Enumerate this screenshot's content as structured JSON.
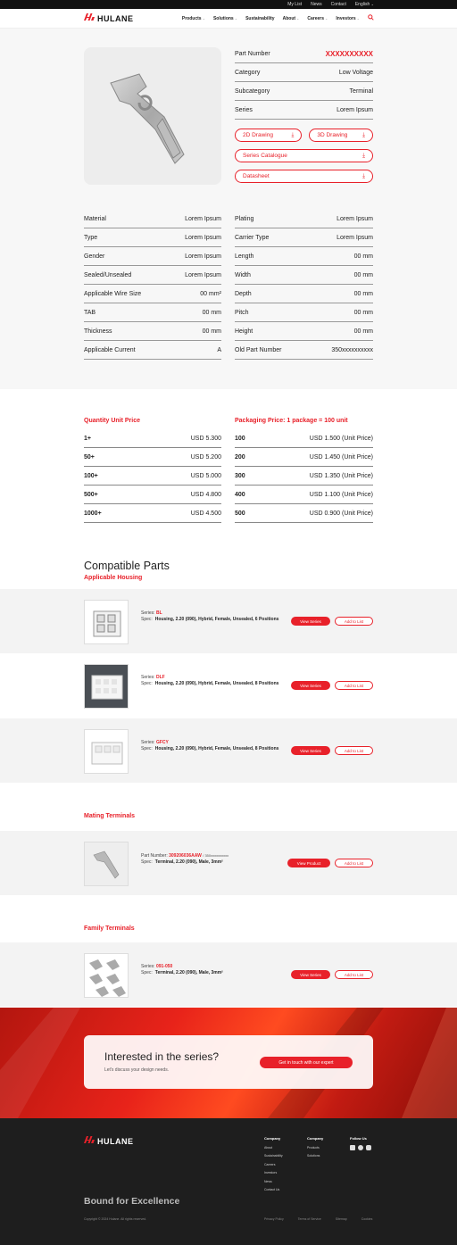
{
  "topbar": {
    "my_list": "My List",
    "news": "News",
    "contact": "Contact",
    "language": "English"
  },
  "nav": {
    "brand": "HULANE",
    "links": [
      "Products",
      "Solutions",
      "Sustainability",
      "About",
      "Careers",
      "Investors"
    ]
  },
  "product": {
    "part_number_label": "Part Number",
    "part_number": "XXXXXXXXXX",
    "category_label": "Category",
    "category": "Low Voltage",
    "subcategory_label": "Subcategory",
    "subcategory": "Terminal",
    "series_label": "Series",
    "series": "Lorem Ipsum",
    "btn_2d": "2D Drawing",
    "btn_3d": "3D Drawing",
    "btn_catalogue": "Series Catalogue",
    "btn_datasheet": "Datasheet"
  },
  "specs_left": [
    {
      "k": "Material",
      "v": "Lorem Ipsum"
    },
    {
      "k": "Type",
      "v": "Lorem Ipsum"
    },
    {
      "k": "Gender",
      "v": "Lorem Ipsum"
    },
    {
      "k": "Sealed/Unsealed",
      "v": "Lorem Ipsum"
    },
    {
      "k": "Applicable Wire Size",
      "v": "00 mm²"
    },
    {
      "k": "TAB",
      "v": "00 mm"
    },
    {
      "k": "Thickness",
      "v": "00 mm"
    },
    {
      "k": "Applicable Current",
      "v": "A"
    }
  ],
  "specs_right": [
    {
      "k": "Plating",
      "v": "Lorem Ipsum"
    },
    {
      "k": "Carrier Type",
      "v": "Lorem Ipsum"
    },
    {
      "k": "Length",
      "v": "00 mm"
    },
    {
      "k": "Width",
      "v": "00 mm"
    },
    {
      "k": "Depth",
      "v": "00 mm"
    },
    {
      "k": "Pitch",
      "v": "00 mm"
    },
    {
      "k": "Height",
      "v": "00 mm"
    },
    {
      "k": "Old Part Number",
      "v": "350xxxxxxxxxx"
    }
  ],
  "pricing": {
    "qty_title": "Quantity Unit Price",
    "pkg_title": "Packaging Price: 1 package = 100 unit",
    "qty": [
      {
        "q": "1+",
        "p": "USD 5.300"
      },
      {
        "q": "50+",
        "p": "USD 5.200"
      },
      {
        "q": "100+",
        "p": "USD 5.000"
      },
      {
        "q": "500+",
        "p": "USD 4.800"
      },
      {
        "q": "1000+",
        "p": "USD 4.500"
      }
    ],
    "pkg": [
      {
        "q": "100",
        "p": "USD 1.500 (Unit Price)"
      },
      {
        "q": "200",
        "p": "USD 1.450 (Unit Price)"
      },
      {
        "q": "300",
        "p": "USD 1.350 (Unit Price)"
      },
      {
        "q": "400",
        "p": "USD 1.100 (Unit Price)"
      },
      {
        "q": "500",
        "p": "USD 0.900 (Unit Price)"
      }
    ]
  },
  "compat": {
    "title": "Compatible Parts",
    "housing_title": "Applicable Housing",
    "series_label": "Series:",
    "spec_label": "Spec:",
    "view_series": "View Series",
    "add_to_list": "Add to List",
    "view_product": "View Product",
    "housings": [
      {
        "series": "BL",
        "spec": "Housing, 2.20 (090), Hybrid, Female, Unsealed, 6 Positions"
      },
      {
        "series": "DLF",
        "spec": "Housing, 2.20 (090), Hybrid, Female, Unsealed, 8 Positions"
      },
      {
        "series": "GFCY",
        "spec": "Housing, 2.20 (090), Hybrid, Female, Unsealed, 8 Positions"
      }
    ],
    "mating_title": "Mating Terminals",
    "mating": {
      "pn_label": "Part Number:",
      "pn": "309206036AAW",
      "old": "/ 350xxxxxxxxxx",
      "spec": "Terminal, 2.20 (090), Male, 3mm²"
    },
    "family_title": "Family Terminals",
    "family": {
      "series": "091-050",
      "spec": "Terminal, 2.20 (090), Male, 3mm²"
    }
  },
  "banner": {
    "title": "Interested in the series?",
    "subtitle": "Let's discuss your design needs.",
    "cta": "Get in touch with our expert"
  },
  "footer": {
    "brand": "HULANE",
    "tagline": "Bound for Excellence",
    "company_title": "Company",
    "company": [
      "About",
      "Sustainability",
      "Careers",
      "Investors",
      "News",
      "Contact Us"
    ],
    "company2_title": "Company",
    "company2": [
      "Products",
      "Solutions"
    ],
    "follow_title": "Follow Us",
    "copyright": "Copyright © 2024 Hulane. All rights reserved.",
    "legal": [
      "Privacy Policy",
      "Terms of Service",
      "Sitemap",
      "Cookies"
    ]
  }
}
